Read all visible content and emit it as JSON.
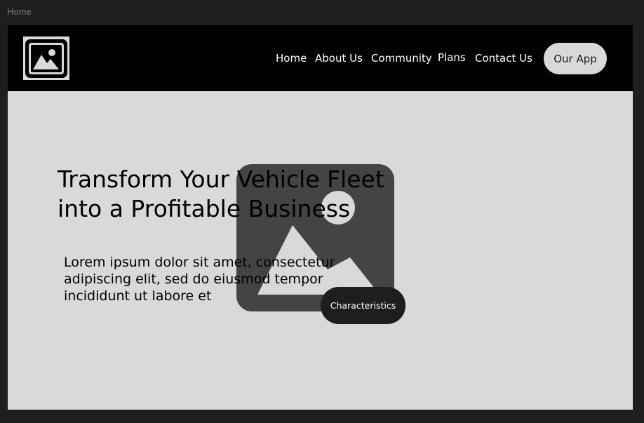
{
  "page_label": "Home",
  "colors": {
    "canvas_bg": "#1e1e1e",
    "navbar_bg": "#000000",
    "hero_bg": "#d9d9d9",
    "placeholder_icon": "#444444",
    "dark_button_bg": "#1e1e1e",
    "light_button_bg": "#d9d9d9"
  },
  "header": {
    "logo_icon": "image-placeholder-icon",
    "nav": [
      {
        "label": "Home"
      },
      {
        "label": "About Us"
      },
      {
        "label": "Community"
      },
      {
        "label": "Plans"
      },
      {
        "label": "Contact Us"
      }
    ],
    "cta_label": "Our App"
  },
  "hero": {
    "title": "Transform Your Vehicle Fleet into a Profitable Business",
    "body": "Lorem ipsum dolor sit amet, consectetur adipiscing elit, sed do eiusmod tempor incididunt ut labore et",
    "image_icon": "image-placeholder-icon",
    "button_label": "Characteristics"
  }
}
